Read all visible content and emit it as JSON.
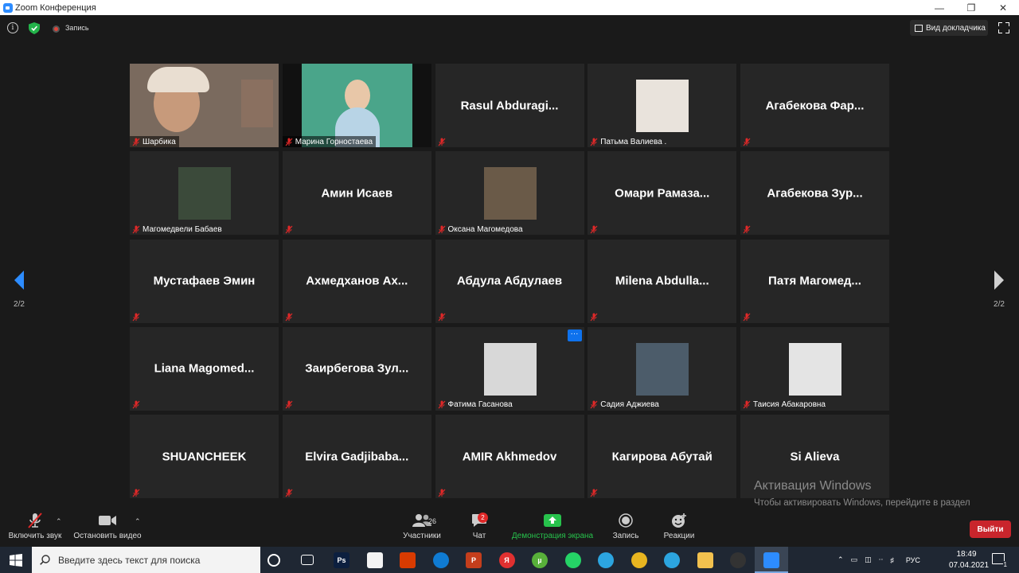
{
  "window": {
    "title": "Zoom Конференция"
  },
  "topbar": {
    "recording_label": "Запись",
    "speaker_view_label": "Вид докладчика"
  },
  "tiles": [
    {
      "name": "Шарбика",
      "type": "video",
      "bg": "#7a6a5e"
    },
    {
      "name": "Марина Горностаева",
      "type": "video",
      "bg": "#4aa58a"
    },
    {
      "name": "Rasul  Abduragi...",
      "type": "name"
    },
    {
      "name": "Патьма Валиева .",
      "type": "photo",
      "photo_bg": "#e9e3dc",
      "photo_icon": "girl-photo-icon"
    },
    {
      "name": "Агабекова  Фар...",
      "type": "name"
    },
    {
      "name": "Магомедвели Бабаев",
      "type": "photo",
      "photo_bg": "#3b4a3a",
      "photo_icon": "man-photo-icon"
    },
    {
      "name": "Амин Исаев",
      "type": "name"
    },
    {
      "name": "Оксана Магомедова",
      "type": "photo",
      "photo_bg": "#6a5a48",
      "photo_icon": "frame-photo-icon"
    },
    {
      "name": "Омари  Рамаза...",
      "type": "name"
    },
    {
      "name": "Агабекова  Зур...",
      "type": "name"
    },
    {
      "name": "Мустафаев Эмин",
      "type": "name"
    },
    {
      "name": "Ахмедханов  Ах...",
      "type": "name"
    },
    {
      "name": "Абдула Абдулаев",
      "type": "name"
    },
    {
      "name": "Milena  Abdulla...",
      "type": "name"
    },
    {
      "name": "Патя  Магомед...",
      "type": "name"
    },
    {
      "name": "Liana  Magomed...",
      "type": "name"
    },
    {
      "name": "Заирбегова  Зул...",
      "type": "name"
    },
    {
      "name": "Фатима Гасанова",
      "type": "photo",
      "photo_bg": "#d8d8d8",
      "photo_icon": "sunglasses-photo-icon",
      "more": "···"
    },
    {
      "name": "Садия Аджиева",
      "type": "photo",
      "photo_bg": "#4c5c6a",
      "photo_icon": "cat-photo-icon"
    },
    {
      "name": "Таисия Абакаровна",
      "type": "photo",
      "photo_bg": "#e4e4e4",
      "photo_icon": "rose-photo-icon"
    },
    {
      "name": "SHUANCHEEK",
      "type": "name"
    },
    {
      "name": "Elvira  Gadjibaba...",
      "type": "name"
    },
    {
      "name": "AMIR Akhmedov",
      "type": "name"
    },
    {
      "name": "Кагирова Абутай",
      "type": "name"
    },
    {
      "name": "Si Alieva",
      "type": "name",
      "no_mic": true
    }
  ],
  "pagination": {
    "left": "2/2",
    "right": "2/2"
  },
  "watermark": {
    "title": "Активация Windows",
    "text": "Чтобы активировать Windows, перейдите в раздел \"Параметры\"."
  },
  "controls": {
    "unmute": "Включить звук",
    "stop_video": "Остановить видео",
    "participants": "Участники",
    "participants_count": "26",
    "chat": "Чат",
    "chat_badge": "2",
    "share": "Демонстрация экрана",
    "record": "Запись",
    "reactions": "Реакции",
    "leave": "Выйти"
  },
  "colors": {
    "accent": "#2D8CFF",
    "share_green": "#27c24c",
    "leave_red": "#c9252c"
  },
  "taskbar": {
    "search_placeholder": "Введите здесь текст для поиска",
    "language": "РУС",
    "time": "18:49",
    "date": "07.04.2021",
    "notification_count": "1",
    "apps": [
      {
        "name": "cortana-icon",
        "label": ""
      },
      {
        "name": "task-view-icon",
        "label": ""
      },
      {
        "name": "photoshop-icon",
        "label": "Ps",
        "color": "#0c1f3f"
      },
      {
        "name": "store-icon",
        "label": "",
        "color": "#f3f3f3"
      },
      {
        "name": "office-icon",
        "label": "",
        "color": "#d83b01"
      },
      {
        "name": "edge-icon",
        "label": "",
        "color": "#0f7bd3"
      },
      {
        "name": "powerpoint-icon",
        "label": "P",
        "color": "#c43e1c"
      },
      {
        "name": "yandex-icon",
        "label": "Я",
        "color": "#e03030"
      },
      {
        "name": "utorrent-icon",
        "label": "µ",
        "color": "#58b03a"
      },
      {
        "name": "whatsapp-icon",
        "label": "",
        "color": "#25d366"
      },
      {
        "name": "telegram-icon",
        "label": "",
        "color": "#2ca5e0"
      },
      {
        "name": "chrome-icon",
        "label": "",
        "color": "#e8b520"
      },
      {
        "name": "telegram-2-icon",
        "label": "",
        "color": "#2ca5e0"
      },
      {
        "name": "explorer-icon",
        "label": "",
        "color": "#f2c14e"
      },
      {
        "name": "obs-icon",
        "label": "",
        "color": "#333333"
      },
      {
        "name": "zoom-taskbar-icon",
        "label": "",
        "color": "#2D8CFF"
      }
    ]
  }
}
